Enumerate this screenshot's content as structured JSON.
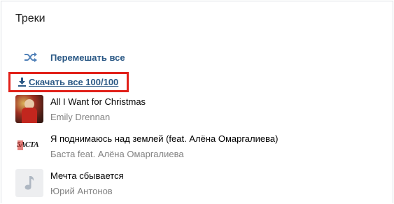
{
  "header": {
    "title": "Треки"
  },
  "actions": {
    "shuffle_label": "Перемешать все",
    "download_label": "Скачать все 100/100"
  },
  "tracks": [
    {
      "title": "All I Want for Christmas",
      "artist": "Emily Drennan",
      "cover": "photo-cover"
    },
    {
      "title": "Я поднимаюсь над землей (feat. Алёна Омаргалиева)",
      "artist": "Баста feat. Алёна Омаргалиева",
      "cover": "logo-cover",
      "cover_text": "5ACTA"
    },
    {
      "title": "Мечта сбывается",
      "artist": "Юрий Антонов",
      "cover": "music-note-placeholder"
    }
  ],
  "colors": {
    "link": "#2a5885",
    "highlight": "#e1211a",
    "muted": "#828282"
  }
}
